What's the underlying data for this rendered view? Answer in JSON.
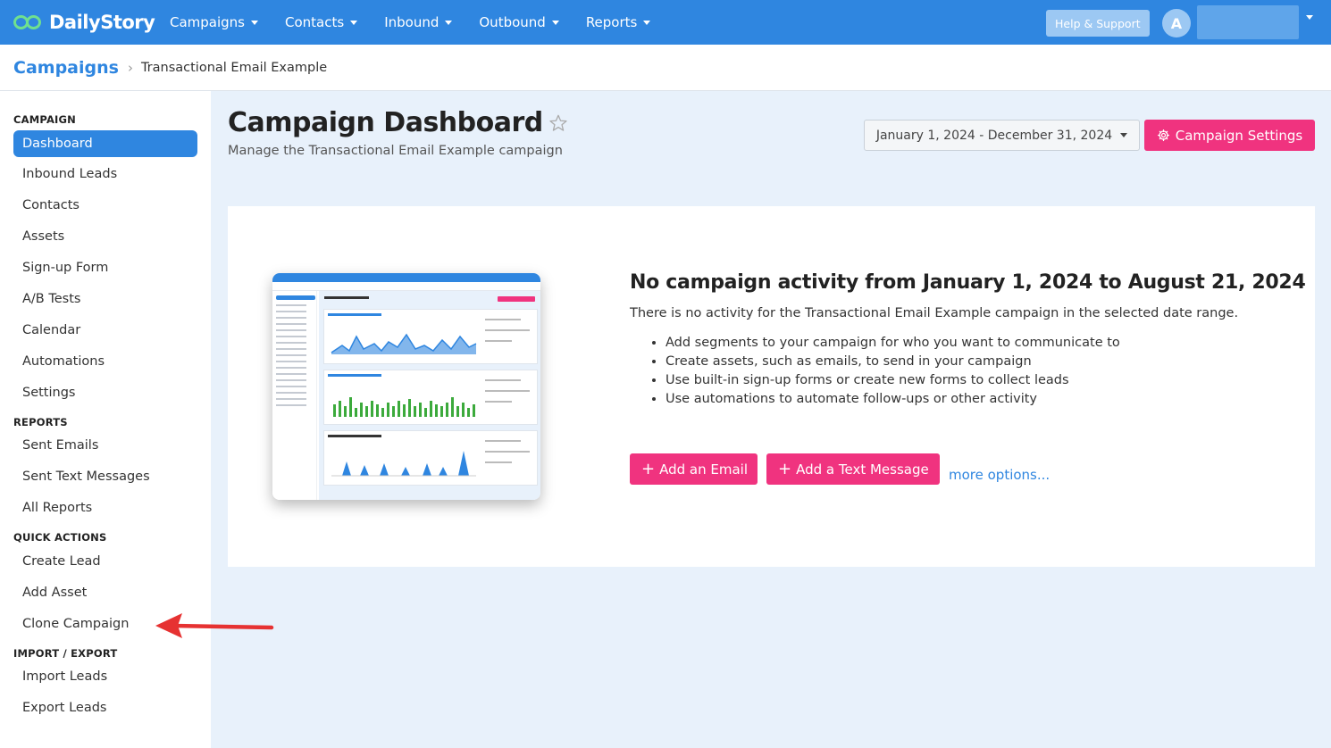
{
  "app": {
    "logo_text": "DailyStory",
    "avatar_initial": "A"
  },
  "topnav": {
    "items": [
      {
        "label": "Campaigns"
      },
      {
        "label": "Contacts"
      },
      {
        "label": "Inbound"
      },
      {
        "label": "Outbound"
      },
      {
        "label": "Reports"
      }
    ],
    "help_label": "Help & Support"
  },
  "breadcrumb": {
    "root": "Campaigns",
    "current": "Transactional Email Example"
  },
  "sidebar": {
    "campaign_head": "CAMPAIGN",
    "campaign_items": [
      "Dashboard",
      "Inbound Leads",
      "Contacts",
      "Assets",
      "Sign-up Form",
      "A/B Tests",
      "Calendar",
      "Automations",
      "Settings"
    ],
    "reports_head": "REPORTS",
    "reports_items": [
      "Sent Emails",
      "Sent Text Messages",
      "All Reports"
    ],
    "quick_head": "QUICK ACTIONS",
    "quick_items": [
      "Create Lead",
      "Add Asset",
      "Clone Campaign"
    ],
    "import_head": "IMPORT / EXPORT",
    "import_items": [
      "Import Leads",
      "Export Leads"
    ]
  },
  "main": {
    "title": "Campaign Dashboard",
    "subtitle": "Manage the Transactional Email Example campaign",
    "date_range": "January 1, 2024 - December 31, 2024",
    "settings_label": "Campaign Settings"
  },
  "empty_state": {
    "title": "No campaign activity from January 1, 2024 to August 21, 2024",
    "description": "There is no activity for the Transactional Email Example campaign in the selected date range.",
    "bullets": [
      "Add segments to your campaign for who you want to communicate to",
      "Create assets, such as emails, to send in your campaign",
      "Use built-in sign-up forms or create new forms to collect leads",
      "Use automations to automate follow-ups or other activity"
    ],
    "add_email_label": "Add an Email",
    "add_text_label": "Add a Text Message",
    "more_label": "more options..."
  },
  "colors": {
    "primary": "#2f86e0",
    "accent_pink": "#f0337f",
    "background": "#e8f1fb",
    "annotation_red": "#e63232"
  }
}
